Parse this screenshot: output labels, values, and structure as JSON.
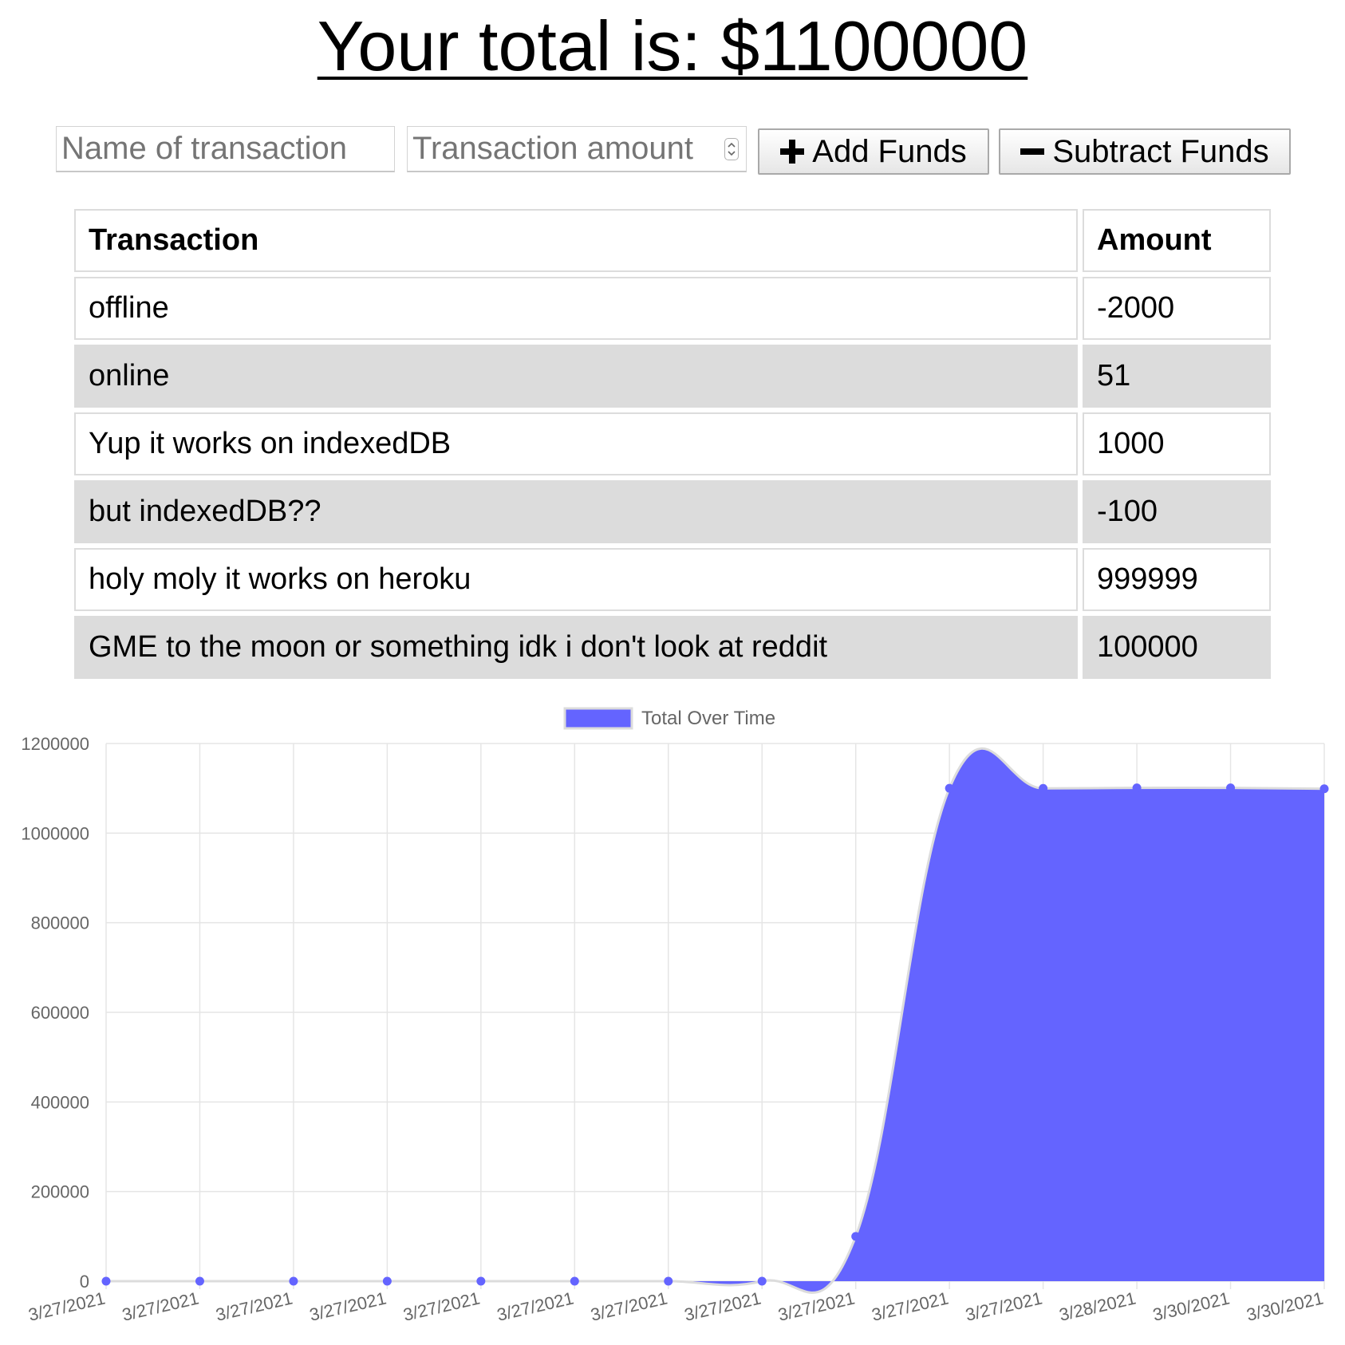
{
  "header": {
    "title": "Your total is: $1100000"
  },
  "form": {
    "name_placeholder": "Name of transaction",
    "amount_placeholder": "Transaction amount",
    "add_label": "Add Funds",
    "subtract_label": "Subtract Funds",
    "add_icon": "plus-icon",
    "subtract_icon": "minus-icon"
  },
  "table": {
    "headers": [
      "Transaction",
      "Amount"
    ],
    "rows": [
      {
        "name": "offline",
        "amount": "-2000"
      },
      {
        "name": "online",
        "amount": "51"
      },
      {
        "name": "Yup it works on indexedDB",
        "amount": "1000"
      },
      {
        "name": "but indexedDB??",
        "amount": "-100"
      },
      {
        "name": "holy moly it works on heroku",
        "amount": "999999"
      },
      {
        "name": "GME to the moon or something idk i don't look at reddit",
        "amount": "100000"
      }
    ]
  },
  "chart_data": {
    "type": "area",
    "categories": [
      "3/27/2021",
      "3/27/2021",
      "3/27/2021",
      "3/27/2021",
      "3/27/2021",
      "3/27/2021",
      "3/27/2021",
      "3/27/2021",
      "3/27/2021",
      "3/27/2021",
      "3/27/2021",
      "3/28/2021",
      "3/30/2021",
      "3/30/2021"
    ],
    "series": [
      {
        "name": "Total Over Time",
        "values": [
          1,
          1,
          1,
          1,
          1,
          1,
          1,
          1,
          100000,
          1100000,
          1099900,
          1100900,
          1100951,
          1098951
        ]
      }
    ],
    "ylim": [
      0,
      1200000
    ],
    "yticks": [
      0,
      200000,
      400000,
      600000,
      800000,
      1000000,
      1200000
    ],
    "grid": true,
    "legend": "top-center",
    "fill_color": "#6464ff",
    "line_color": "#dcdcdc",
    "point_color": "#6464ff"
  }
}
